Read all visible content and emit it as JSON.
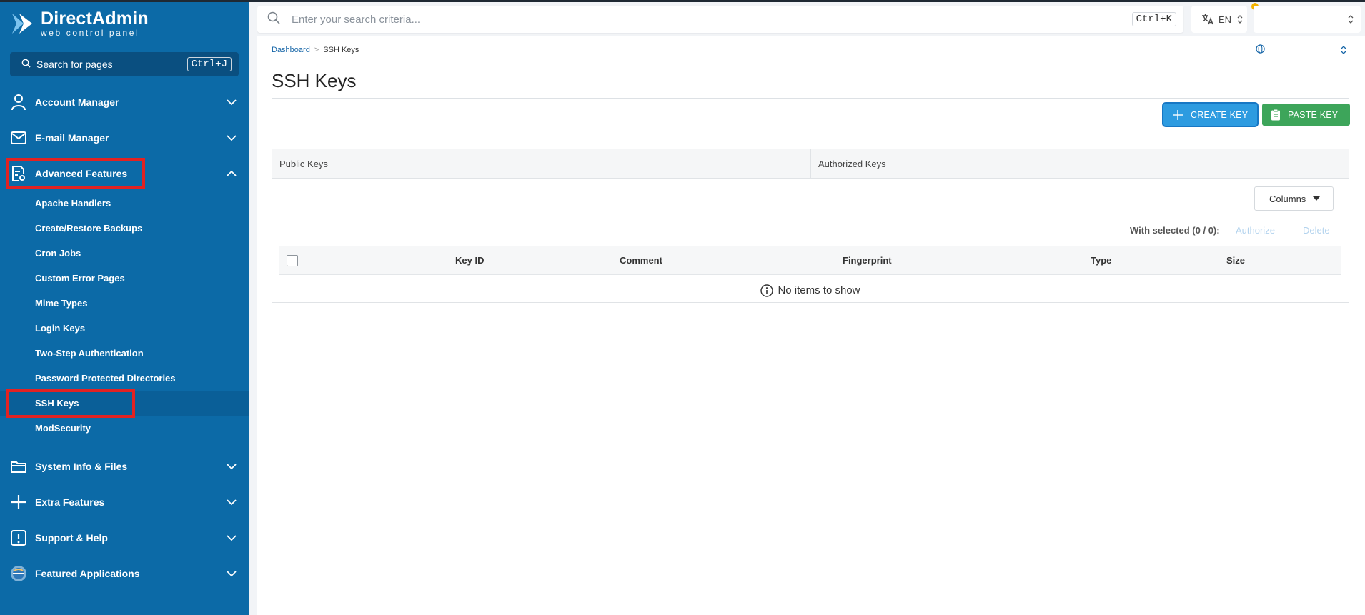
{
  "app": {
    "brand_title": "DirectAdmin",
    "brand_subtitle": "web control panel"
  },
  "sidebar": {
    "search_label": "Search for pages",
    "search_shortcut": "Ctrl+J",
    "sections": [
      {
        "label": "Account Manager",
        "icon": "user-icon",
        "expanded": false
      },
      {
        "label": "E-mail Manager",
        "icon": "mail-icon",
        "expanded": false
      },
      {
        "label": "Advanced Features",
        "icon": "advanced-features-icon",
        "expanded": true
      },
      {
        "label": "System Info & Files",
        "icon": "folder-icon",
        "expanded": false
      },
      {
        "label": "Extra Features",
        "icon": "plus-icon",
        "expanded": false
      },
      {
        "label": "Support & Help",
        "icon": "help-icon",
        "expanded": false
      },
      {
        "label": "Featured Applications",
        "icon": "apps-icon",
        "expanded": false
      }
    ],
    "advanced_items": [
      {
        "label": "Apache Handlers"
      },
      {
        "label": "Create/Restore Backups"
      },
      {
        "label": "Cron Jobs"
      },
      {
        "label": "Custom Error Pages"
      },
      {
        "label": "Mime Types"
      },
      {
        "label": "Login Keys"
      },
      {
        "label": "Two-Step Authentication"
      },
      {
        "label": "Password Protected Directories"
      },
      {
        "label": "SSH Keys",
        "active": true
      },
      {
        "label": "ModSecurity"
      }
    ],
    "highlight_color": "#e32222"
  },
  "topbar": {
    "search_placeholder": "Enter your search criteria...",
    "search_shortcut": "Ctrl+K",
    "language": "EN"
  },
  "breadcrumb": {
    "items": [
      "Dashboard",
      "SSH Keys"
    ]
  },
  "page": {
    "title": "SSH Keys",
    "create_key_label": "CREATE KEY",
    "paste_key_label": "PASTE KEY",
    "tabs": [
      "Public Keys",
      "Authorized Keys"
    ],
    "columns_button": "Columns",
    "with_selected": "With selected (0 / 0):",
    "authorize_label": "Authorize",
    "delete_label": "Delete",
    "table_headers": [
      "Key ID",
      "Comment",
      "Fingerprint",
      "Type",
      "Size"
    ],
    "empty_message": "No items to show"
  },
  "colors": {
    "sidebar_bg": "#0c6aa7",
    "create_button": "#2d9be0",
    "paste_button": "#3da55a"
  }
}
